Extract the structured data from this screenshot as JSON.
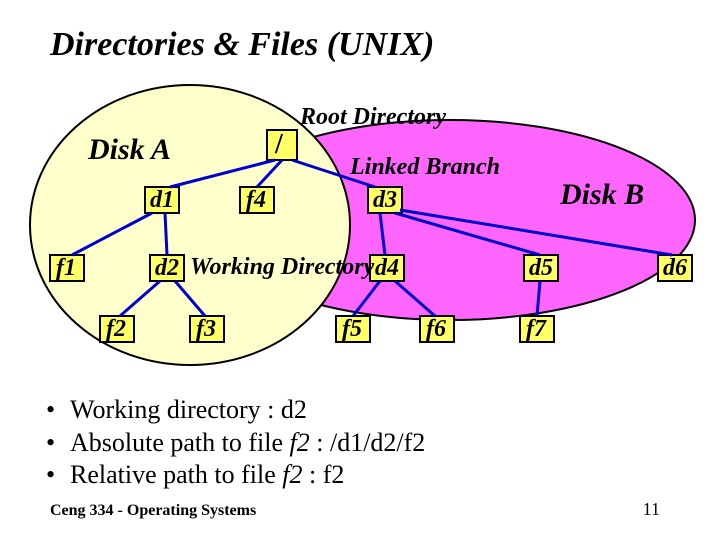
{
  "title": "Directories & Files (UNIX)",
  "diagram": {
    "rootLabel": "Root Directory",
    "diskALabel": "Disk A",
    "diskBLabel": "Disk B",
    "linkedBranchLabel": "Linked Branch",
    "workingDirLabel": "Working Directory",
    "nodes": {
      "root": "/",
      "d1": "d1",
      "d2": "d2",
      "d3": "d3",
      "d4": "d4",
      "d5": "d5",
      "d6": "d6",
      "f1": "f1",
      "f2": "f2",
      "f3": "f3",
      "f4": "f4",
      "f5": "f5",
      "f6": "f6",
      "f7": "f7"
    }
  },
  "bullets": {
    "b1a": "Working directory :  ",
    "b1b": "d2",
    "b2a": "Absolute path to file ",
    "b2f": "f2",
    "b2b": " : /d1/d2/f2",
    "b3a": "Relative  path to file ",
    "b3f": "f2",
    "b3b": " : f2"
  },
  "footer": {
    "left": "Ceng 334 - Operating Systems",
    "right": "11"
  }
}
